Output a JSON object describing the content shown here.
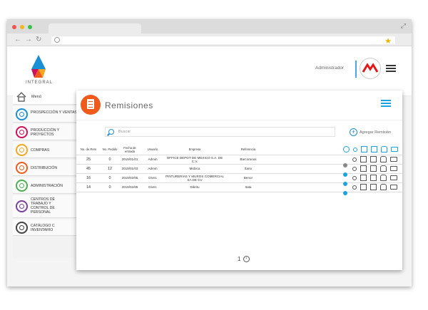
{
  "header": {
    "logo_text": "INTEGRAL",
    "user_label": "Administrador"
  },
  "sidebar": {
    "menu_label": "Menú",
    "items": [
      {
        "label": "PROSPECCIÓN Y VENTAS",
        "color": "#1a8fd6"
      },
      {
        "label": "PRODUCCIÓN Y PROYECTOS",
        "color": "#d0105a"
      },
      {
        "label": "COMPRAS",
        "color": "#f5a623"
      },
      {
        "label": "DISTRIBUCIÓN",
        "color": "#f05a1a"
      },
      {
        "label": "ADMINISTRACIÓN",
        "color": "#4caf50"
      },
      {
        "label": "CENTROS DE TRABAJO Y CONTROL DE PERSONAL",
        "color": "#7b3fa0"
      },
      {
        "label": "CATÁLOGO C INVENTARIO",
        "color": "#444444"
      }
    ]
  },
  "main": {
    "title": "Remisiones",
    "search_placeholder": "Buscar",
    "add_label": "Agregar  Remisión",
    "columns": [
      "No. de Rem",
      "No. Pedido",
      "Fecha de entrada",
      "Usuario",
      "Empresa",
      "Referencia"
    ],
    "rows": [
      {
        "rem": "25",
        "pedido": "0",
        "fecha": "2019/01/01",
        "usuario": "Admin",
        "empresa": "OFFICE DEPOT DE MEXICO S.A. DE C.V.",
        "referencia": "Barcomnos",
        "status": "grey"
      },
      {
        "rem": "45",
        "pedido": "12",
        "fecha": "2019/01/03",
        "usuario": "Admin",
        "empresa": "Mobica",
        "referencia": "Itano",
        "status": "blue"
      },
      {
        "rem": "16",
        "pedido": "0",
        "fecha": "2019/02/05",
        "usuario": "Divnc",
        "empresa": "PINTURERIAS Y MUROS COMERCIAL SA DE CV",
        "referencia": "Benor",
        "status": "blue"
      },
      {
        "rem": "14",
        "pedido": "0",
        "fecha": "2019/02/05",
        "usuario": "Divnc",
        "empresa": "Dikritu",
        "referencia": "Itata",
        "status": "blue"
      }
    ],
    "page_number": "1"
  }
}
